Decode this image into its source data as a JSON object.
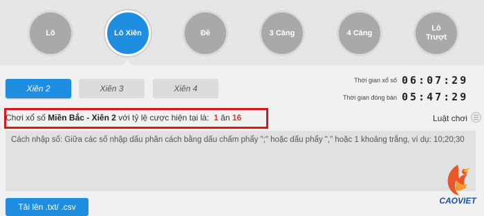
{
  "categories": [
    {
      "label": "Lô",
      "active": false
    },
    {
      "label": "Lô Xiên",
      "active": true
    },
    {
      "label": "Đề",
      "active": false
    },
    {
      "label": "3 Càng",
      "active": false
    },
    {
      "label": "4 Càng",
      "active": false
    },
    {
      "label": "Lô\nTrượt",
      "active": false
    }
  ],
  "tabs": [
    {
      "label": "Xiên 2",
      "active": true
    },
    {
      "label": "Xiên 3",
      "active": false
    },
    {
      "label": "Xiên 4",
      "active": false
    }
  ],
  "timers": {
    "draw_label": "Thời gian xổ số",
    "draw_value": "06:07:29",
    "close_label": "Thời gian đóng bàn",
    "close_value": "05:47:29"
  },
  "info": {
    "prefix": "Chơi xổ số",
    "game": "Miền Bắc - Xiên 2",
    "middle": "với tỷ lệ cược hiện tại là:",
    "odds_left": "1",
    "odds_sep": "ăn",
    "odds_right": "16"
  },
  "rules_label": "Luật chơi",
  "input": {
    "placeholder": "Cách nhập số: Giữa các số nhập dấu phân cách bằng dấu chấm phẩy \";\" hoặc dấu phẩy \",\" hoặc 1 khoảng trắng, ví dụ: 10;20;30"
  },
  "upload_label": "Tải lên .txt/ .csv",
  "logo_text": "CAOVIET",
  "colors": {
    "accent": "#1f8ee0",
    "highlight": "#e0131e",
    "odds": "#e23a2b"
  }
}
